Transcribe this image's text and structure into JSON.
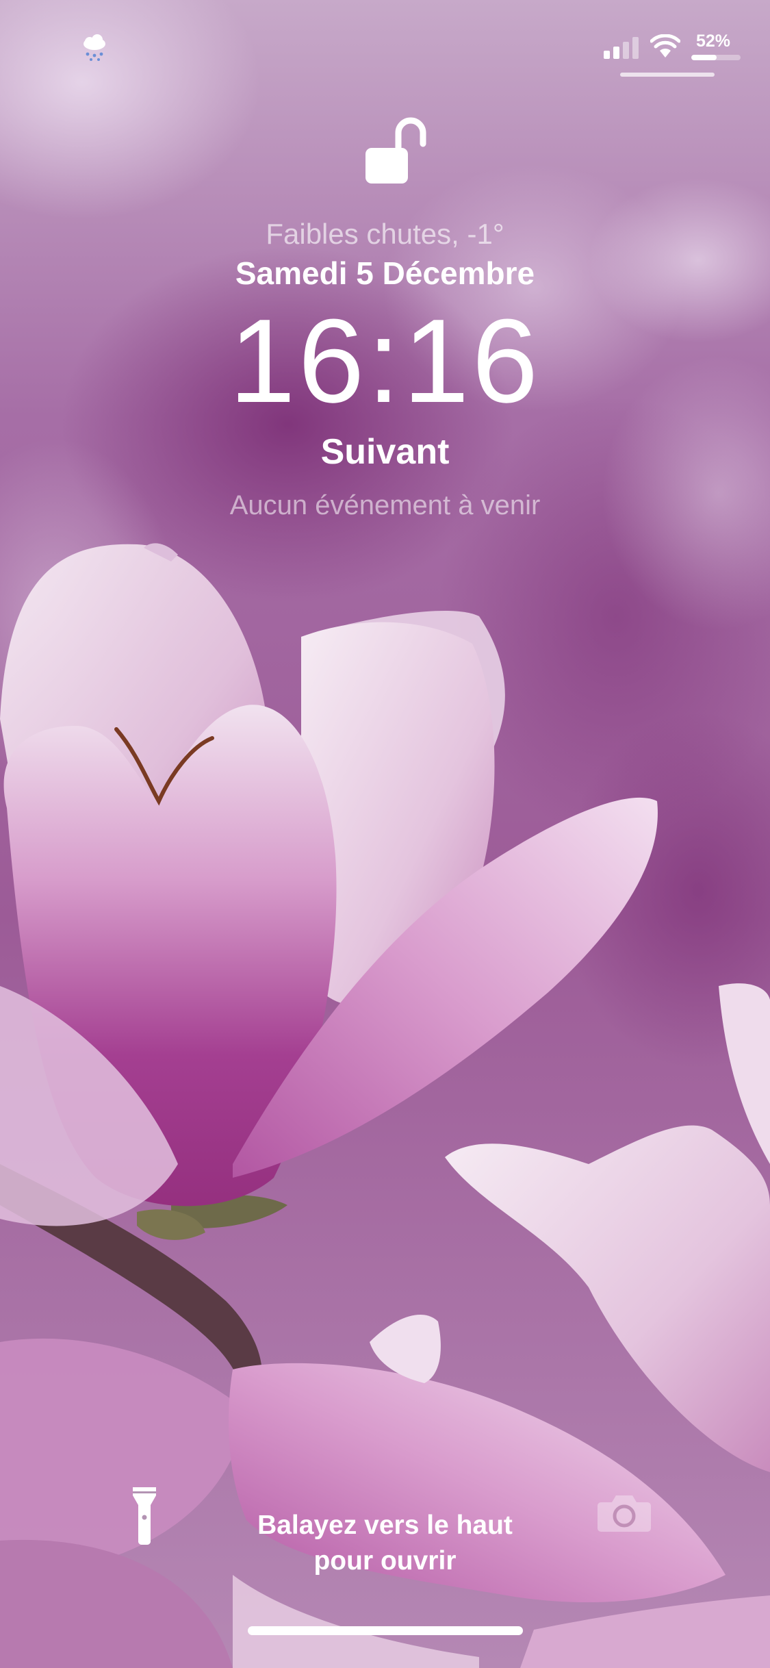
{
  "status_bar": {
    "weather_icon": "cloud-snow-icon",
    "signal_icon": "cellular-signal-icon",
    "wifi_icon": "wifi-icon",
    "battery_label": "52%",
    "battery_level": 0.52
  },
  "lock": {
    "icon": "unlocked-padlock-icon",
    "weather_text": "Faibles chutes, -1°",
    "date": "Samedi 5 Décembre",
    "time": "16:16",
    "next_label": "Suivant",
    "next_event": "Aucun événement à venir"
  },
  "bottom": {
    "flashlight_icon": "flashlight-icon",
    "camera_icon": "camera-icon",
    "swipe_line1": "Balayez vers le haut",
    "swipe_line2": "pour ouvrir"
  },
  "colors": {
    "text": "#ffffff",
    "wallpaper_base": "#b07aa8",
    "petal_light": "#f3e4f0",
    "petal_deep": "#a23c8f"
  }
}
